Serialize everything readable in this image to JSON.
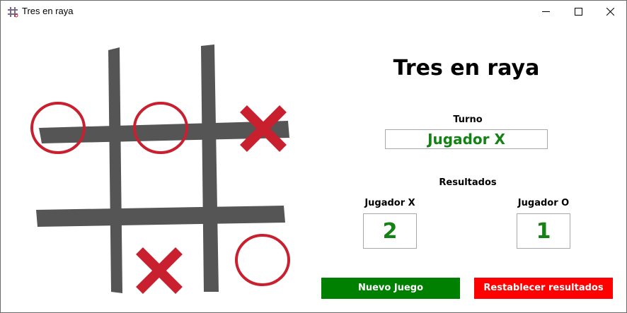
{
  "window": {
    "title": "Tres en raya",
    "controls": {
      "minimize": "minimize-icon",
      "maximize": "maximize-icon",
      "close": "close-icon"
    }
  },
  "board": {
    "cells": [
      "O",
      "O",
      "X",
      "",
      "",
      "",
      "",
      "X",
      "O"
    ],
    "colors": {
      "grid": "#555555",
      "marks": "#c8202e"
    }
  },
  "panel": {
    "heading": "Tres en raya",
    "turn_label": "Turno",
    "turn_value": "Jugador X",
    "results_label": "Resultados",
    "player_x_label": "Jugador X",
    "player_o_label": "Jugador O",
    "player_x_score": "2",
    "player_o_score": "1",
    "new_game_button": "Nuevo Juego",
    "reset_button": "Restablecer resultados"
  },
  "colors": {
    "value_text": "#148214",
    "new_game_bg": "#008000",
    "reset_bg": "#ff0000"
  }
}
